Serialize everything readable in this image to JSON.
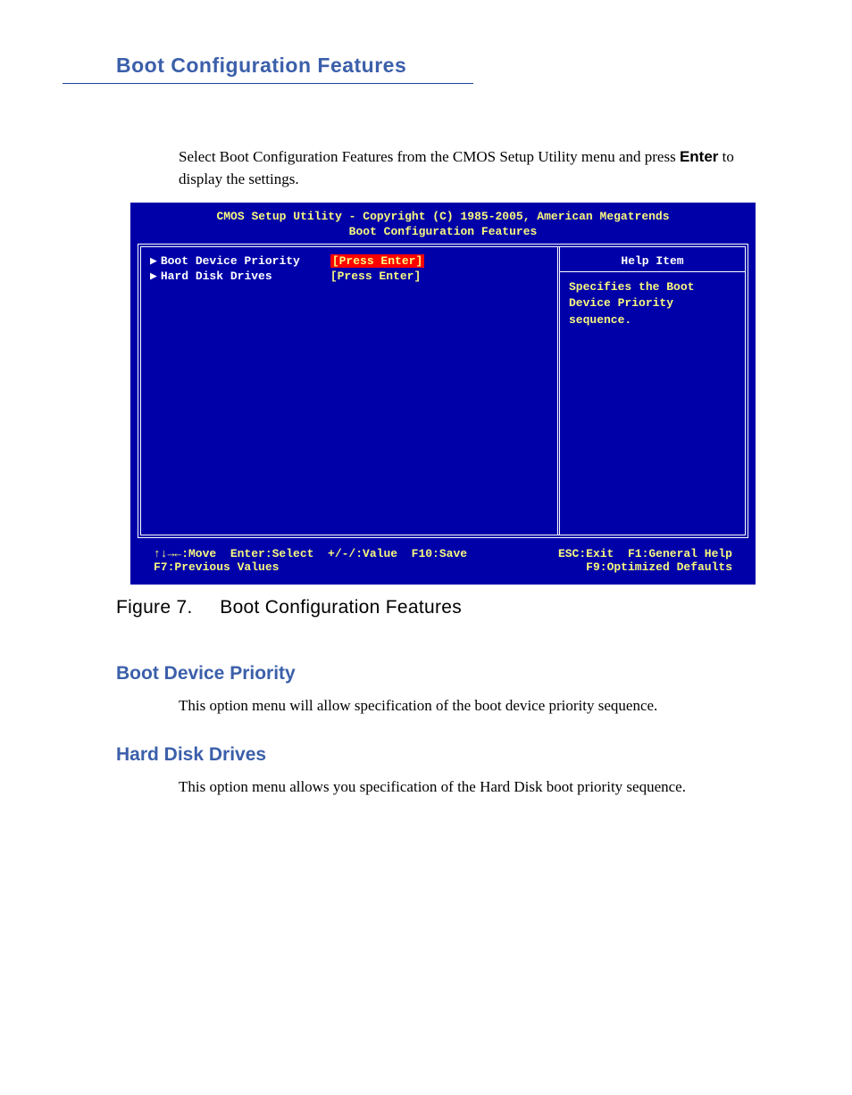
{
  "page": {
    "heading": "Boot Configuration Features",
    "intro_pre": "Select Boot Configuration Features from the CMOS Setup Utility menu and press ",
    "intro_bold": "Enter",
    "intro_post": " to display the settings."
  },
  "bios": {
    "title": "CMOS Setup Utility - Copyright (C) 1985-2005, American Megatrends",
    "subtitle": "Boot Configuration Features",
    "items": [
      {
        "label": "Boot Device Priority",
        "value": "[Press Enter]",
        "selected": true
      },
      {
        "label": "Hard Disk Drives",
        "value": "[Press Enter]",
        "selected": false
      }
    ],
    "help": {
      "title": "Help Item",
      "body": "Specifies the Boot Device Priority sequence."
    },
    "footer": {
      "row1_left": "↑↓→←:Move  Enter:Select  +/-/:Value  F10:Save",
      "row1_right": "ESC:Exit  F1:General Help",
      "row2_left": "F7:Previous Values",
      "row2_right": "F9:Optimized Defaults"
    }
  },
  "figure": {
    "label": "Figure 7.",
    "title": "Boot Configuration Features"
  },
  "sections": {
    "s1": {
      "heading": "Boot Device Priority",
      "body": "This option menu will allow specification of the boot device priority sequence."
    },
    "s2": {
      "heading": "Hard Disk Drives",
      "body": "This option menu allows you specification of the Hard Disk boot priority sequence."
    }
  }
}
